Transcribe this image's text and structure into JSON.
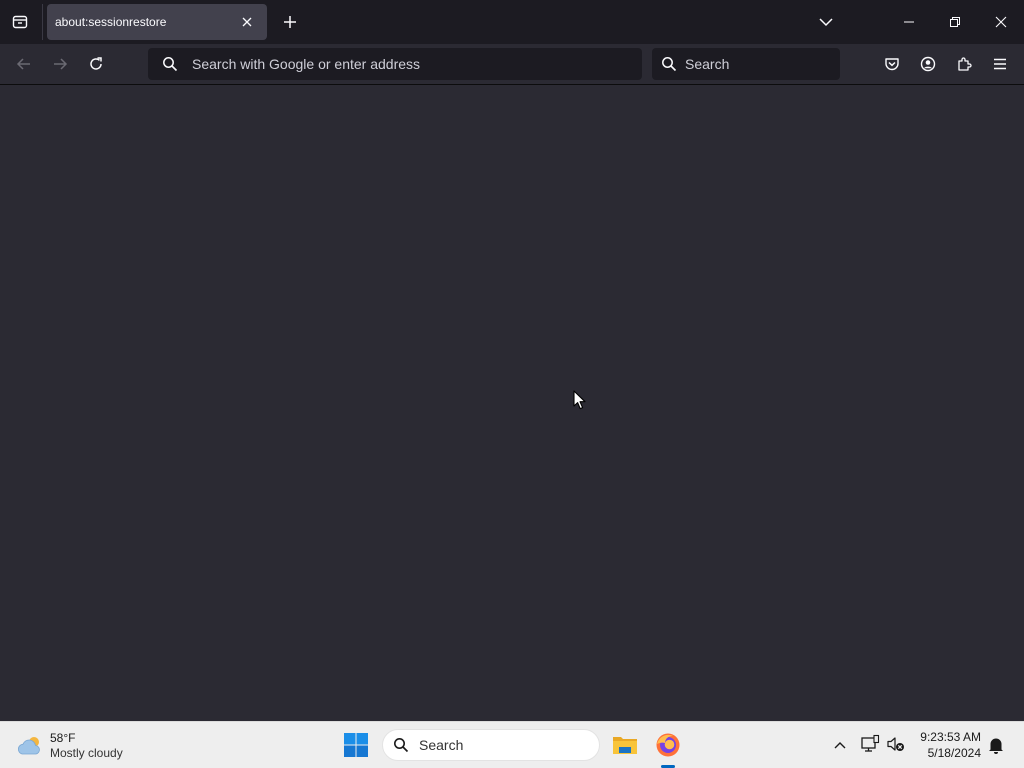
{
  "browser": {
    "tab": {
      "title": "about:sessionrestore"
    },
    "urlbar": {
      "placeholder": "Search with Google or enter address"
    },
    "searchbar": {
      "placeholder": "Search"
    },
    "icons": [
      "tab-list-icon",
      "close-icon",
      "plus-icon",
      "chevron-down-icon",
      "minimize-icon",
      "restore-icon",
      "close-window-icon",
      "back-arrow-icon",
      "forward-arrow-icon",
      "reload-icon",
      "search-icon",
      "pocket-icon",
      "account-icon",
      "extensions-icon",
      "menu-icon"
    ]
  },
  "taskbar": {
    "weather": {
      "temp": "58°F",
      "condition": "Mostly cloudy"
    },
    "search": {
      "label": "Search"
    },
    "clock": {
      "time": "9:23:53 AM",
      "date": "5/18/2024"
    },
    "apps": [
      "file-explorer",
      "firefox"
    ],
    "accent": "#0067c0"
  },
  "colors": {
    "titlebar": "#1c1b22",
    "toolbar": "#2b2a33",
    "tab_active": "#42414d",
    "field": "#1c1b22",
    "taskbar": "#eeeeee"
  }
}
